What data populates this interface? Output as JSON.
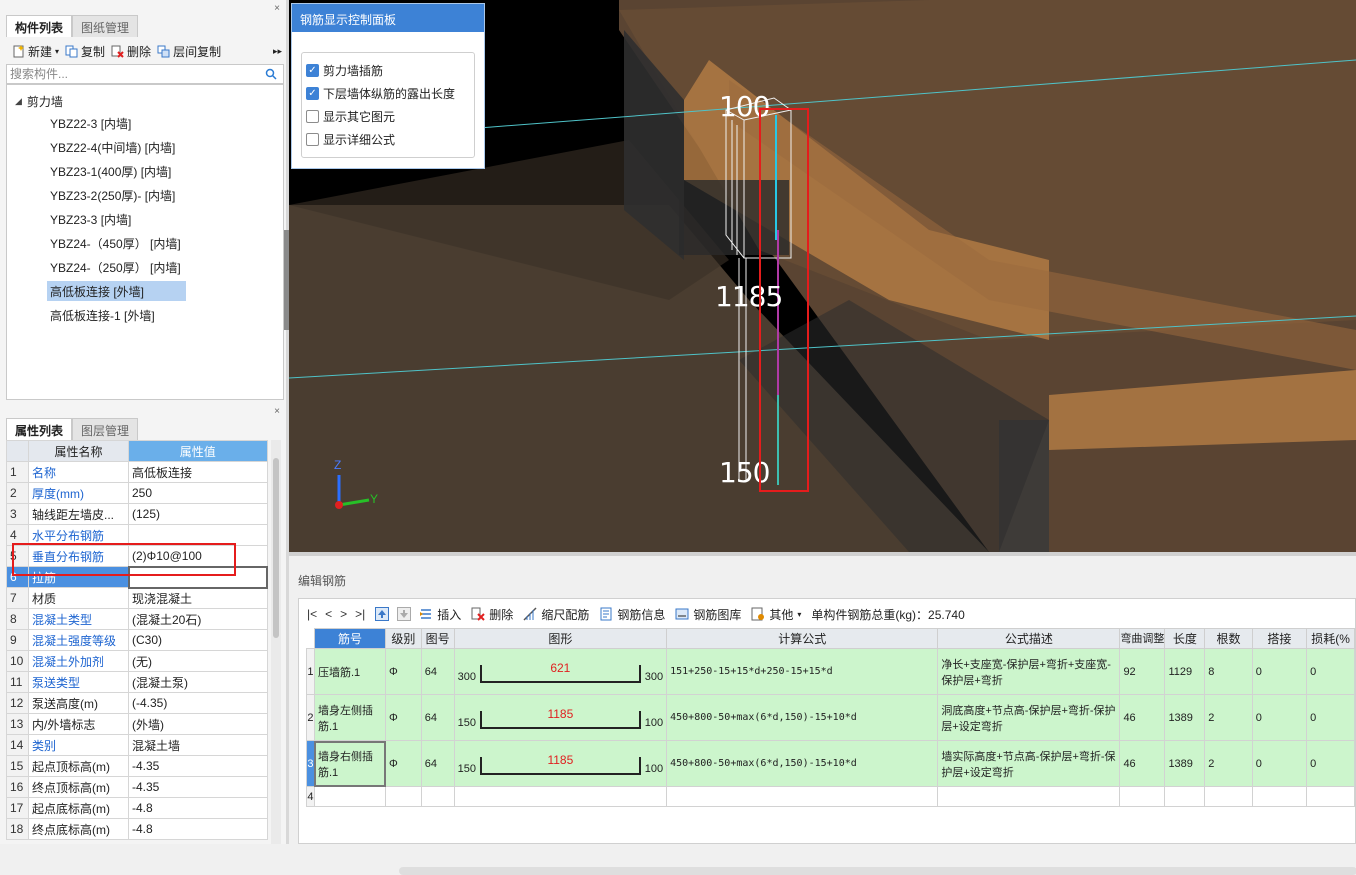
{
  "component_panel": {
    "tabs": [
      "构件列表",
      "图纸管理"
    ],
    "close": "×",
    "toolbar": {
      "new": "新建",
      "copy": "复制",
      "delete": "删除",
      "floor_copy": "层间复制",
      "more": "▸▸"
    },
    "search_placeholder": "搜索构件...",
    "tree_root": "剪力墙",
    "tree_items": [
      "YBZ22-3 [内墙]",
      "YBZ22-4(中间墙) [内墙]",
      "YBZ23-1(400厚) [内墙]",
      "YBZ23-2(250厚)- [内墙]",
      "YBZ23-3 [内墙]",
      "YBZ24-（450厚） [内墙]",
      "YBZ24-（250厚） [内墙]",
      "高低板连接 [外墙]",
      "高低板连接-1 [外墙]"
    ],
    "selected_index": 7
  },
  "property_panel": {
    "tabs": [
      "属性列表",
      "图层管理"
    ],
    "close": "×",
    "headers": {
      "name": "属性名称",
      "value": "属性值"
    },
    "rows": [
      {
        "n": "1",
        "name": "名称",
        "value": "高低板连接"
      },
      {
        "n": "2",
        "name": "厚度(mm)",
        "value": "250"
      },
      {
        "n": "3",
        "name": "轴线距左墙皮...",
        "value": "(125)"
      },
      {
        "n": "4",
        "name": "水平分布钢筋",
        "value": ""
      },
      {
        "n": "5",
        "name": "垂直分布钢筋",
        "value": "(2)Φ10@100"
      },
      {
        "n": "6",
        "name": "拉筋",
        "value": ""
      },
      {
        "n": "7",
        "name": "材质",
        "value": "现浇混凝土"
      },
      {
        "n": "8",
        "name": "混凝土类型",
        "value": "(混凝土20石)"
      },
      {
        "n": "9",
        "name": "混凝土强度等级",
        "value": "(C30)"
      },
      {
        "n": "10",
        "name": "混凝土外加剂",
        "value": "(无)"
      },
      {
        "n": "11",
        "name": "泵送类型",
        "value": "(混凝土泵)"
      },
      {
        "n": "12",
        "name": "泵送高度(m)",
        "value": "(-4.35)"
      },
      {
        "n": "13",
        "name": "内/外墙标志",
        "value": "(外墙)"
      },
      {
        "n": "14",
        "name": "类别",
        "value": "混凝土墙"
      },
      {
        "n": "15",
        "name": "起点顶标高(m)",
        "value": "-4.35"
      },
      {
        "n": "16",
        "name": "终点顶标高(m)",
        "value": "-4.35"
      },
      {
        "n": "17",
        "name": "起点底标高(m)",
        "value": "-4.8"
      },
      {
        "n": "18",
        "name": "终点底标高(m)",
        "value": "-4.8"
      }
    ]
  },
  "control_panel": {
    "title": "钢筋显示控制面板",
    "options": [
      {
        "label": "剪力墙插筋",
        "checked": true
      },
      {
        "label": "下层墙体纵筋的露出长度",
        "checked": true
      },
      {
        "label": "显示其它图元",
        "checked": false
      },
      {
        "label": "显示详细公式",
        "checked": false
      }
    ]
  },
  "viewport_labels": {
    "top": "100",
    "middle": "1185",
    "bottom": "150",
    "axis_z": "Z",
    "axis_y": "Y"
  },
  "edit_rebar": {
    "title": "编辑钢筋",
    "nav": [
      "|<",
      "<",
      ">",
      ">|"
    ],
    "toolbar": {
      "insert": "插入",
      "delete": "删除",
      "scale": "缩尺配筋",
      "info": "钢筋信息",
      "library": "钢筋图库",
      "other": "其他",
      "total": "单构件钢筋总重(kg)：25.740"
    },
    "headers": [
      "筋号",
      "级别",
      "图号",
      "图形",
      "计算公式",
      "公式描述",
      "弯曲调整",
      "长度",
      "根数",
      "搭接",
      "损耗(%"
    ],
    "rows": [
      {
        "n": "1",
        "name": "压墙筋.1",
        "grade": "Φ",
        "fig": "64",
        "left": "300",
        "mid": "621",
        "right": "300",
        "formula": "151+250-15+15*d+250-15+15*d",
        "desc": "净长+支座宽-保护层+弯折+支座宽-保护层+弯折",
        "bend": "92",
        "length": "1129",
        "count": "8",
        "lap": "0",
        "loss": "0"
      },
      {
        "n": "2",
        "name": "墙身左侧插筋.1",
        "grade": "Φ",
        "fig": "64",
        "left": "150",
        "mid": "1185",
        "right": "100",
        "formula": "450+800-50+max(6*d,150)-15+10*d",
        "desc": "洞底高度+节点高-保护层+弯折-保护层+设定弯折",
        "bend": "46",
        "length": "1389",
        "count": "2",
        "lap": "0",
        "loss": "0"
      },
      {
        "n": "3",
        "name": "墙身右侧插筋.1",
        "grade": "Φ",
        "fig": "64",
        "left": "150",
        "mid": "1185",
        "right": "100",
        "formula": "450+800-50+max(6*d,150)-15+10*d",
        "desc": "墙实际高度+节点高-保护层+弯折-保护层+设定弯折",
        "bend": "46",
        "length": "1389",
        "count": "2",
        "lap": "0",
        "loss": "0"
      }
    ],
    "empty_row": "4"
  }
}
